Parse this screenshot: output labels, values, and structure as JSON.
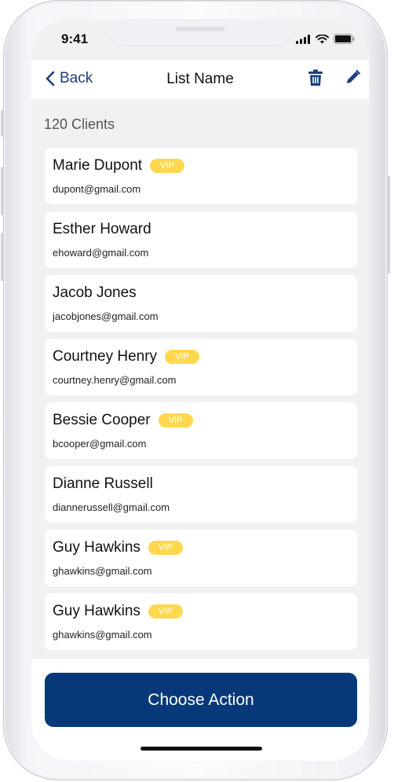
{
  "status": {
    "time": "9:41"
  },
  "nav": {
    "back_label": "Back",
    "title": "List Name",
    "icons": [
      "chevron-left-icon",
      "trash-icon",
      "pencil-icon"
    ]
  },
  "summary": {
    "count_label": "120 Clients"
  },
  "clients": [
    {
      "name": "Marie Dupont",
      "email": "dupont@gmail.com",
      "vip": true
    },
    {
      "name": "Esther Howard",
      "email": "ehoward@gmail.com",
      "vip": false
    },
    {
      "name": "Jacob Jones",
      "email": "jacobjones@gmail.com",
      "vip": false
    },
    {
      "name": "Courtney Henry",
      "email": "courtney.henry@gmail.com",
      "vip": true
    },
    {
      "name": "Bessie Cooper",
      "email": "bcooper@gmail.com",
      "vip": true
    },
    {
      "name": "Dianne Russell",
      "email": "diannerussell@gmail.com",
      "vip": false
    },
    {
      "name": "Guy Hawkins",
      "email": "ghawkins@gmail.com",
      "vip": true
    },
    {
      "name": "Guy Hawkins",
      "email": "ghawkins@gmail.com",
      "vip": true
    }
  ],
  "vip_label": "VIP",
  "action": {
    "label": "Choose Action"
  },
  "colors": {
    "accent": "#07397a",
    "vip": "#ffd84f",
    "link": "#1d3d7c"
  }
}
